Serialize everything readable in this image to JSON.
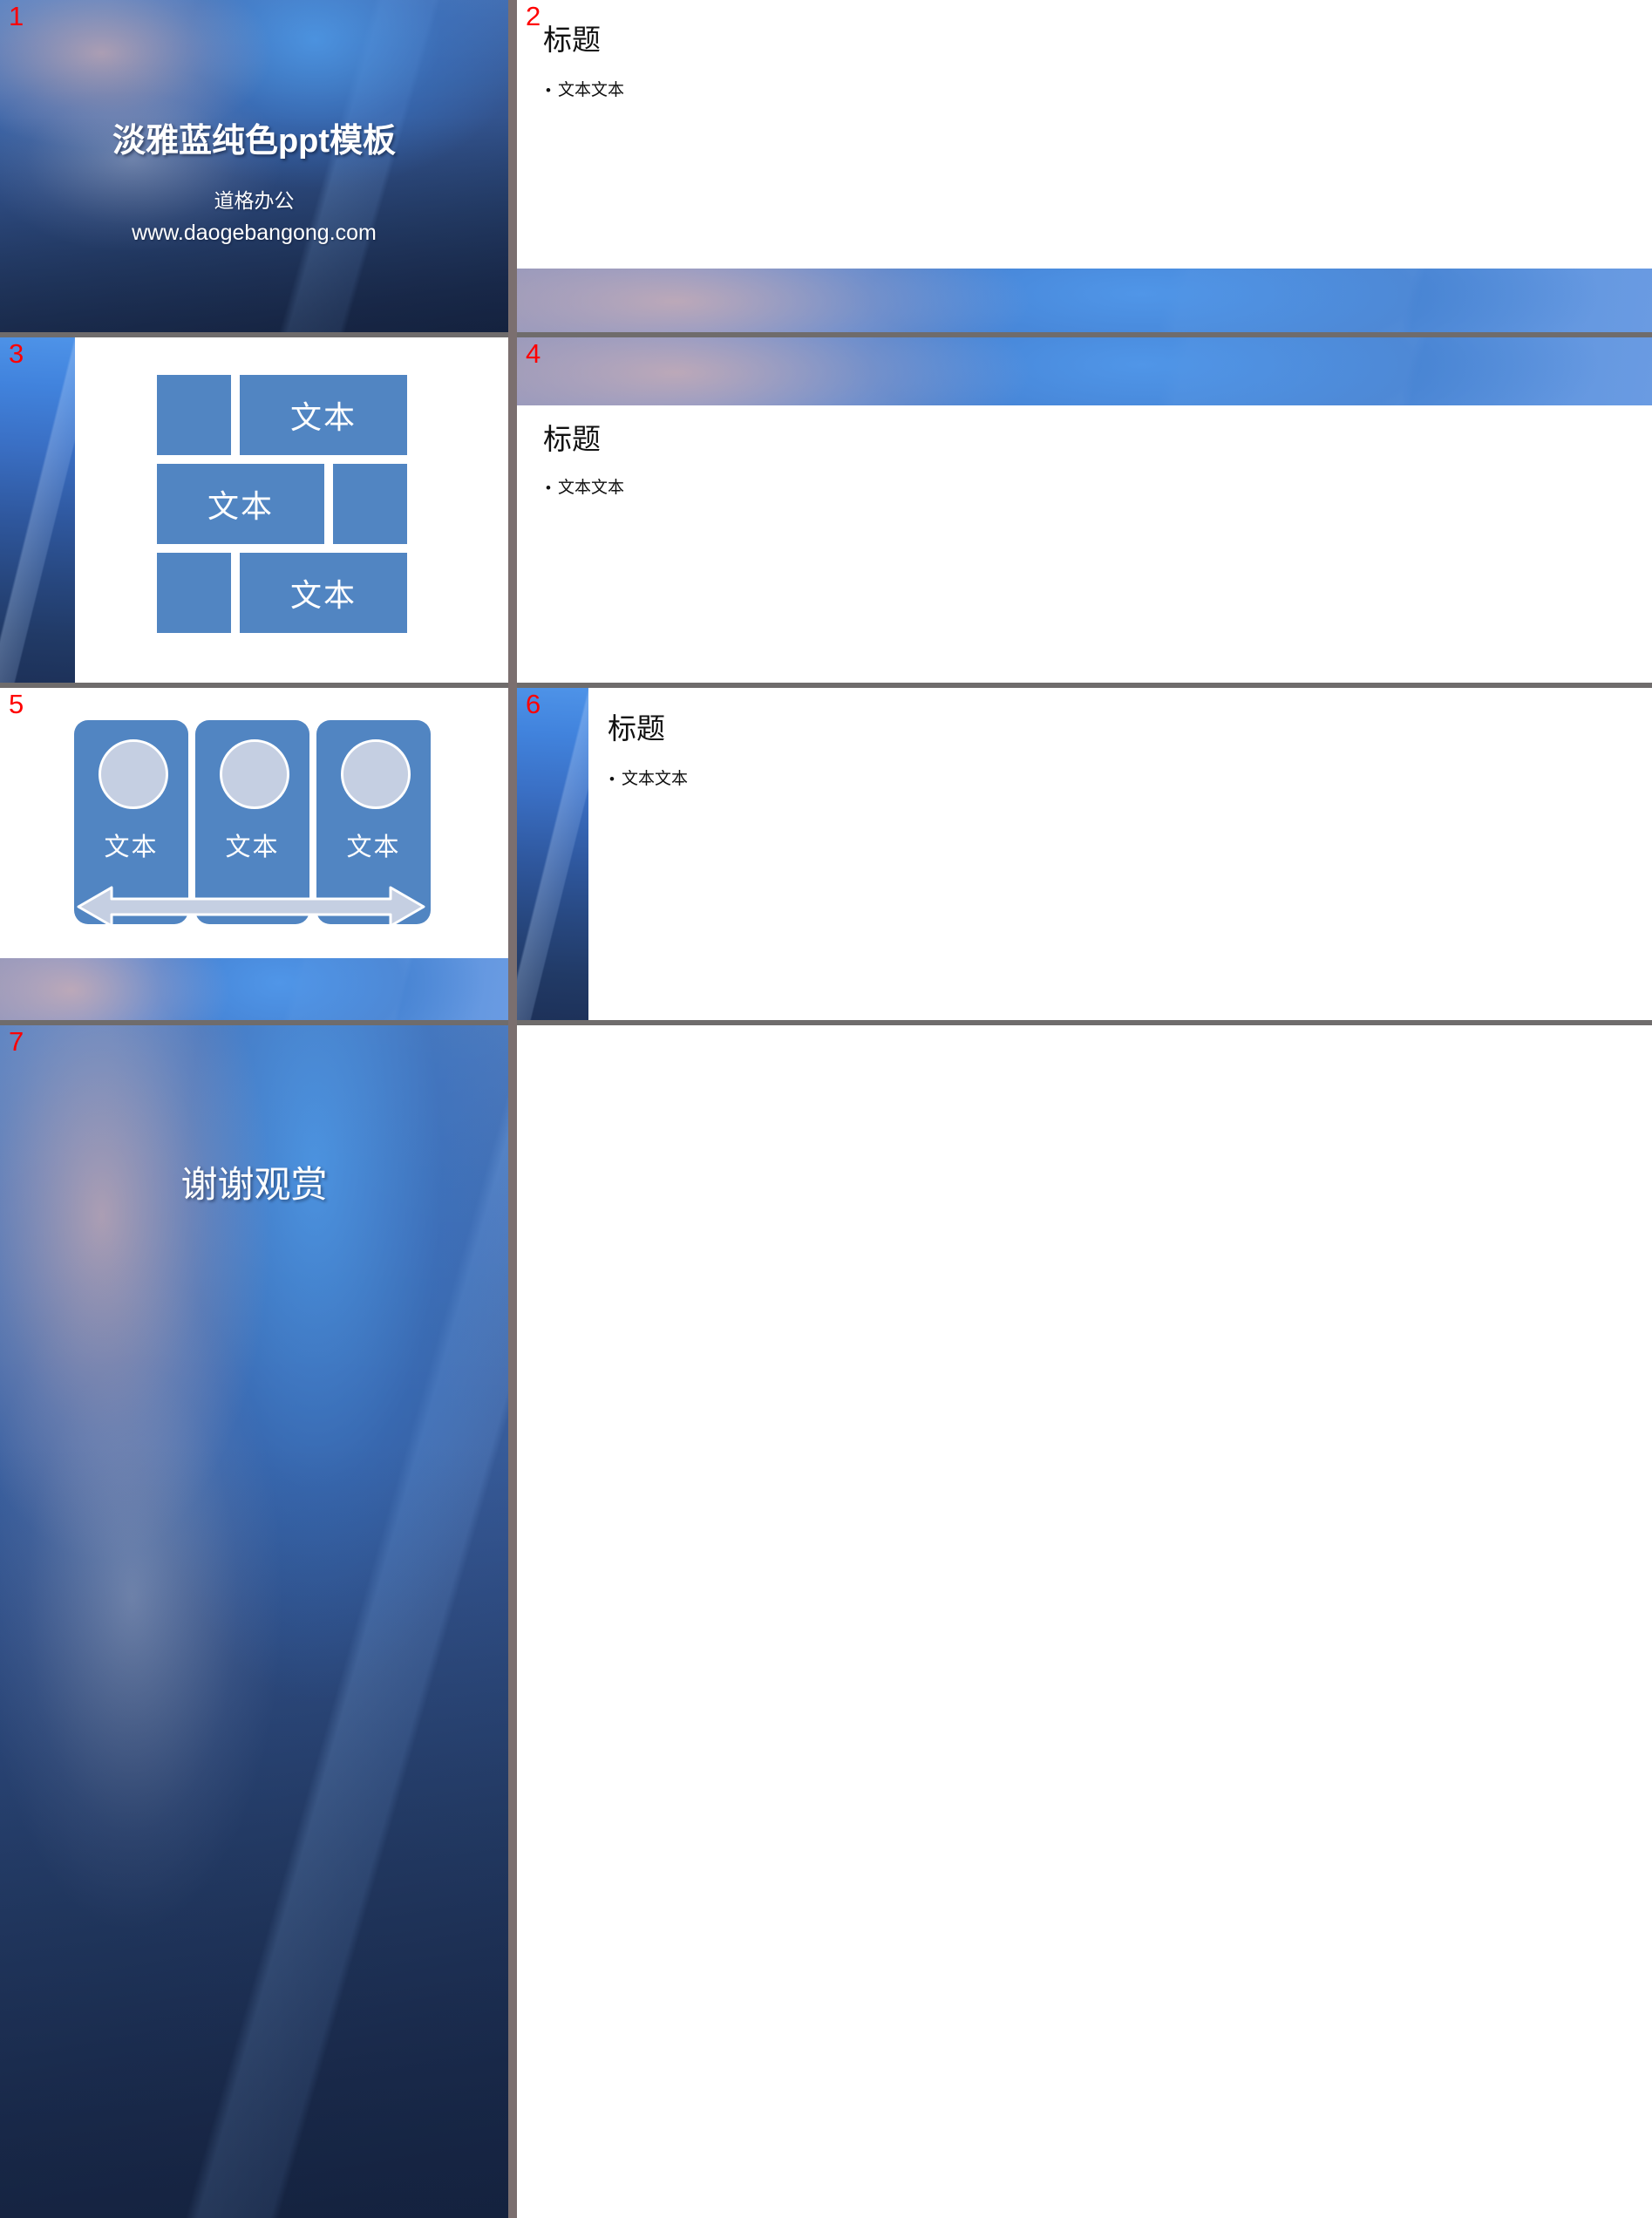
{
  "document": {
    "type": "powerpoint-template-preview",
    "slide_count": 7,
    "grid": "2 columns x 4 rows",
    "accent_color": "#5185c2",
    "slide_number_color": "#ff0000",
    "divider_color": "#6f6c6c",
    "background_description": "blurred blue gradient photo"
  },
  "slides": [
    {
      "number": "1",
      "kind": "title",
      "title": "淡雅蓝纯色ppt模板",
      "subtitle": "道格办公",
      "url": "www.daogebangong.com"
    },
    {
      "number": "2",
      "kind": "content-top-heading",
      "heading": "标题",
      "bullets": [
        "文本文本"
      ]
    },
    {
      "number": "3",
      "kind": "mosaic",
      "blocks": [
        {
          "label": ""
        },
        {
          "label": "文本"
        },
        {
          "label": "文本"
        },
        {
          "label": ""
        },
        {
          "label": ""
        },
        {
          "label": "文本"
        }
      ]
    },
    {
      "number": "4",
      "kind": "content-banner-heading",
      "heading": "标题",
      "bullets": [
        "文本文本"
      ]
    },
    {
      "number": "5",
      "kind": "three-cards",
      "cards": [
        {
          "label": "文本"
        },
        {
          "label": "文本"
        },
        {
          "label": "文本"
        }
      ],
      "arrow": "double-headed-horizontal-arrow"
    },
    {
      "number": "6",
      "kind": "content-side-strip",
      "heading": "标题",
      "bullets": [
        "文本文本"
      ]
    },
    {
      "number": "7",
      "kind": "closing",
      "title": "谢谢观赏"
    }
  ]
}
